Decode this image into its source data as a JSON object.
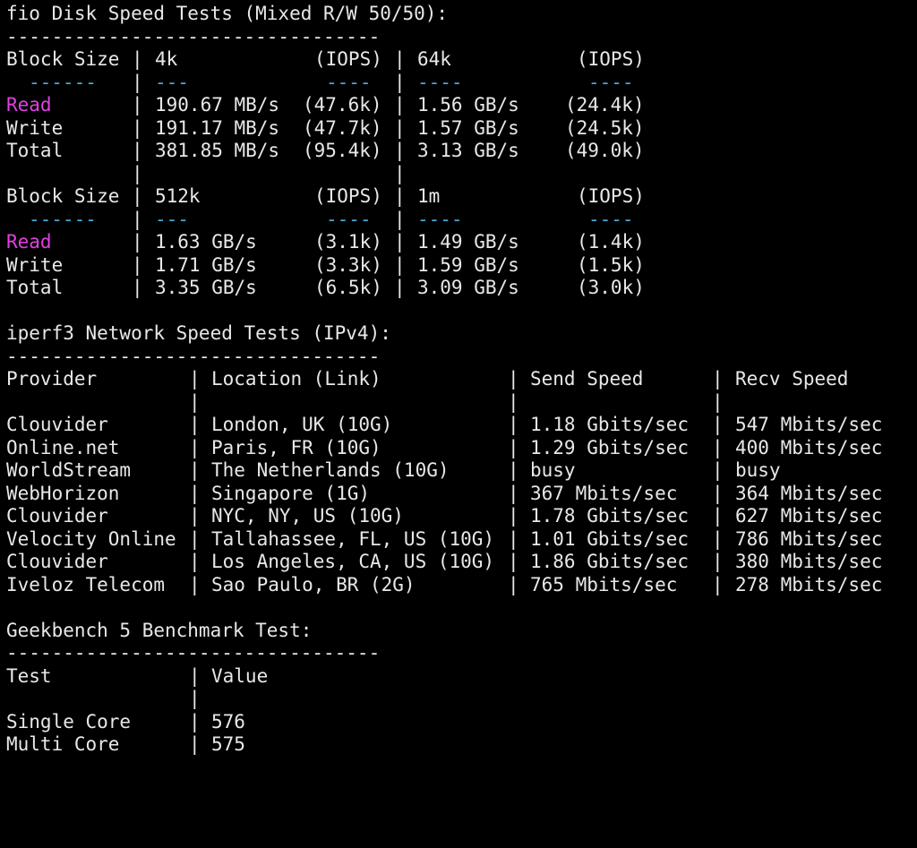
{
  "fio": {
    "title": "fio Disk Speed Tests (Mixed R/W 50/50):",
    "rule": "---------------------------------",
    "header_label": "Block Size",
    "dash_row": {
      "label": "------",
      "value": "---",
      "iops": "----"
    },
    "iops_header": "(IOPS)",
    "groups": [
      {
        "sizes": [
          "4k",
          "64k"
        ],
        "rows": [
          {
            "label": "Read",
            "v1": "190.67 MB/s",
            "i1": "(47.6k)",
            "v2": "1.56 GB/s",
            "i2": "(24.4k)"
          },
          {
            "label": "Write",
            "v1": "191.17 MB/s",
            "i1": "(47.7k)",
            "v2": "1.57 GB/s",
            "i2": "(24.5k)"
          },
          {
            "label": "Total",
            "v1": "381.85 MB/s",
            "i1": "(95.4k)",
            "v2": "3.13 GB/s",
            "i2": "(49.0k)"
          }
        ]
      },
      {
        "sizes": [
          "512k",
          "1m"
        ],
        "rows": [
          {
            "label": "Read",
            "v1": "1.63 GB/s",
            "i1": "(3.1k)",
            "v2": "1.49 GB/s",
            "i2": "(1.4k)"
          },
          {
            "label": "Write",
            "v1": "1.71 GB/s",
            "i1": "(3.3k)",
            "v2": "1.59 GB/s",
            "i2": "(1.5k)"
          },
          {
            "label": "Total",
            "v1": "3.35 GB/s",
            "i1": "(6.5k)",
            "v2": "3.09 GB/s",
            "i2": "(3.0k)"
          }
        ]
      }
    ]
  },
  "iperf": {
    "title": "iperf3 Network Speed Tests (IPv4):",
    "rule": "---------------------------------",
    "headers": {
      "provider": "Provider",
      "location": "Location (Link)",
      "send": "Send Speed",
      "recv": "Recv Speed"
    },
    "rows": [
      {
        "provider": "Clouvider",
        "location": "London, UK (10G)",
        "send": "1.18 Gbits/sec",
        "recv": "547 Mbits/sec"
      },
      {
        "provider": "Online.net",
        "location": "Paris, FR (10G)",
        "send": "1.29 Gbits/sec",
        "recv": "400 Mbits/sec"
      },
      {
        "provider": "WorldStream",
        "location": "The Netherlands (10G)",
        "send": "busy",
        "recv": "busy"
      },
      {
        "provider": "WebHorizon",
        "location": "Singapore (1G)",
        "send": "367 Mbits/sec",
        "recv": "364 Mbits/sec"
      },
      {
        "provider": "Clouvider",
        "location": "NYC, NY, US (10G)",
        "send": "1.78 Gbits/sec",
        "recv": "627 Mbits/sec"
      },
      {
        "provider": "Velocity Online",
        "location": "Tallahassee, FL, US (10G)",
        "send": "1.01 Gbits/sec",
        "recv": "786 Mbits/sec"
      },
      {
        "provider": "Clouvider",
        "location": "Los Angeles, CA, US (10G)",
        "send": "1.86 Gbits/sec",
        "recv": "380 Mbits/sec"
      },
      {
        "provider": "Iveloz Telecom",
        "location": "Sao Paulo, BR (2G)",
        "send": "765 Mbits/sec",
        "recv": "278 Mbits/sec"
      }
    ]
  },
  "geekbench": {
    "title": "Geekbench 5 Benchmark Test:",
    "rule": "---------------------------------",
    "headers": {
      "test": "Test",
      "value": "Value"
    },
    "rows": [
      {
        "test": "Single Core",
        "value": "576"
      },
      {
        "test": "Multi Core",
        "value": "575"
      }
    ]
  },
  "colors": {
    "background": "#000000",
    "text": "#e8e8e8",
    "dash_accent": "#4aa8d8",
    "read_label": "#e040e0"
  }
}
